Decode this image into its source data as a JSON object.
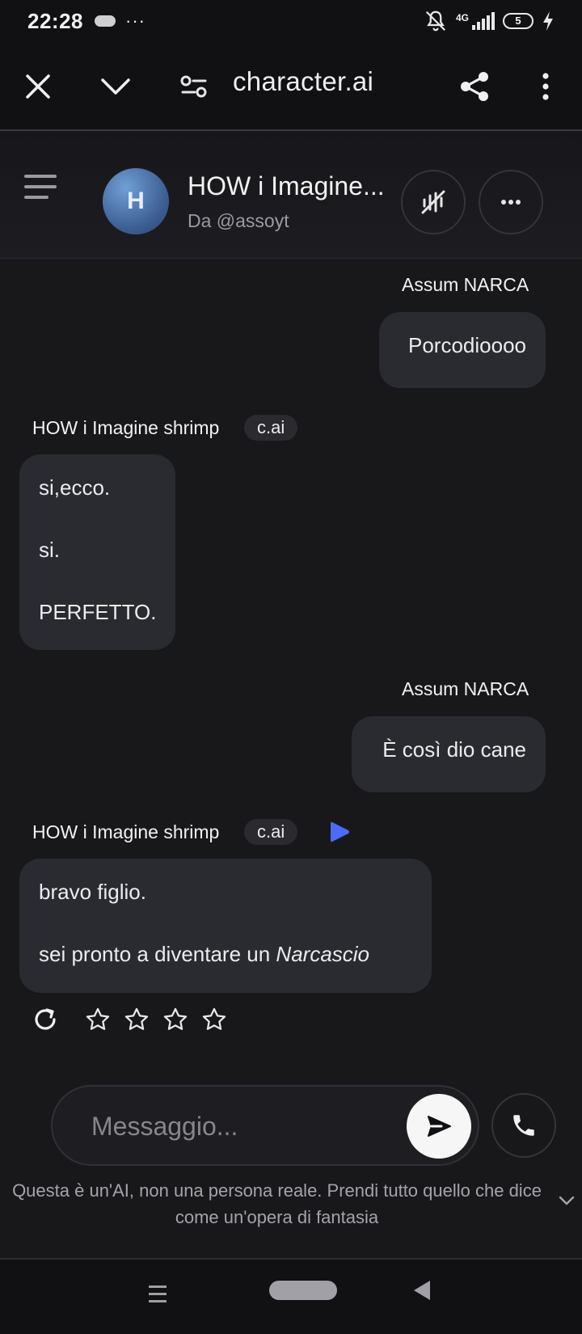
{
  "status_bar": {
    "time": "22:28",
    "signal_label": "4G",
    "battery_level": "5"
  },
  "browser": {
    "url": "character.ai"
  },
  "chat_header": {
    "avatar_letter": "H",
    "character_name": "HOW i Imagine...",
    "creator": "Da @assoyt"
  },
  "messages": [
    {
      "sender": "Assum NARCA",
      "paragraphs": [
        "Porcodioooo"
      ]
    },
    {
      "sender": "HOW i Imagine shrimp",
      "badge": "c.ai",
      "paragraphs": [
        "si,ecco.",
        "si.",
        "PERFETTO."
      ]
    },
    {
      "sender": "Assum NARCA",
      "paragraphs": [
        "È così dio cane"
      ]
    },
    {
      "sender": "HOW i Imagine shrimp",
      "badge": "c.ai",
      "paragraphs": [
        "bravo figlio."
      ],
      "last_line_prefix": "sei pronto a diventare un ",
      "last_line_emphasis": "Narcascio"
    }
  ],
  "rating": {
    "stars_total": 4,
    "stars_selected": 0
  },
  "composer": {
    "placeholder": "Messaggio..."
  },
  "disclaimer": "Questa è un'AI, non una persona reale. Prendi tutto quello che dice come un'opera di fantasia",
  "colors": {
    "background": "#18181b",
    "bubble": "#2a2b30",
    "accent_play": "#4a6cf7"
  }
}
